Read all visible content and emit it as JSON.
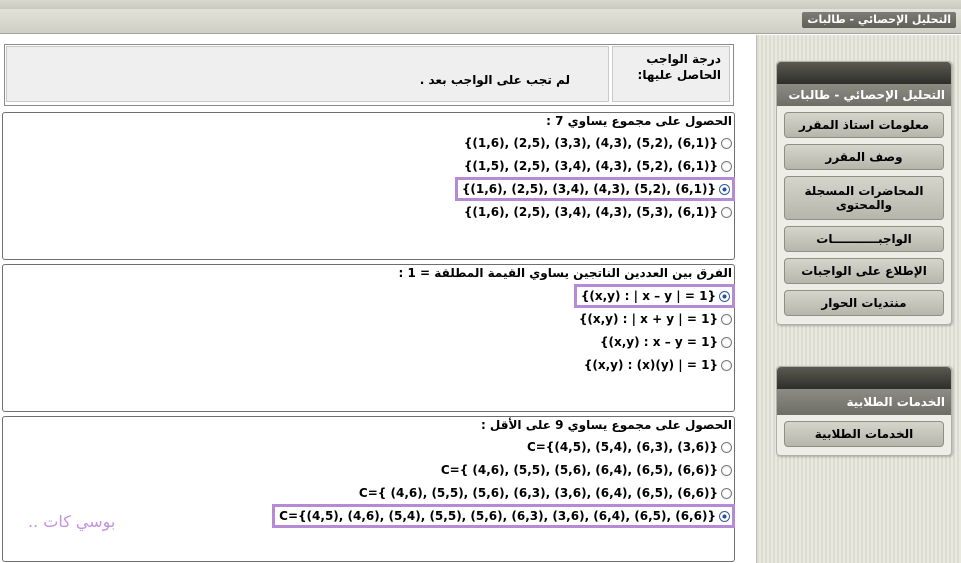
{
  "window": {
    "title": "التحليل الإحصائي - طالبات"
  },
  "grade": {
    "label": "درجة الواجب الحاصل عليها:",
    "value": "لم تجب على الواجب بعد ."
  },
  "questions": [
    {
      "text": "الحصول على مجموع يساوي 7 :",
      "selected_index": 2,
      "options": [
        "{(1,6), (2,5), (3,3), (4,3), (5,2), (6,1)}",
        "{(1,5), (2,5), (3,4), (4,3), (5,2), (6,1)}",
        "{(1,6), (2,5), (3,4), (4,3), (5,2), (6,1)}",
        "{(1,6), (2,5), (3,4), (4,3), (5,3), (6,1)}"
      ]
    },
    {
      "text": "الفرق بين العددين الناتجين يساوي القيمة المطلقة = 1 :",
      "selected_index": 0,
      "options": [
        "{(x,y) : | x – y | = 1}",
        "{(x,y) : | x + y | = 1}",
        "{(x,y) : x – y = 1}",
        "{(x,y) : (x)(y) | = 1}"
      ]
    },
    {
      "text": "الحصول على مجموع يساوي 9 على الأقل :",
      "selected_index": 3,
      "options": [
        "C={(4,5), (5,4), (6,3), (3,6)}",
        "C={ (4,6), (5,5), (5,6), (6,4), (6,5), (6,6)}",
        "C={ (4,6), (5,5), (5,6), (6,3), (3,6), (6,4), (6,5), (6,6)}",
        "C={(4,5), (4,6), (5,4), (5,5), (5,6), (6,3), (3,6), (6,4), (6,5), (6,6)}"
      ]
    }
  ],
  "watermark": "بوسي كات ..",
  "sidebar": {
    "course_panel": {
      "title": "التحليل الإحصائي - طالبات",
      "items": [
        "معلومات استاذ المقرر",
        "وصف المقرر",
        "المحاضرات المسجلة والمحتوى",
        "الواجبـــــــــــات",
        "الإطلاع على الواجبات",
        "منتديات الحوار"
      ]
    },
    "services_panel": {
      "title": "الخدمات الطلابية",
      "items": [
        "الخدمات الطلابية"
      ]
    }
  },
  "colors": {
    "highlight": "#b78ad8",
    "panel_header": "#6e6e66",
    "panel_top": "#2f2f2a"
  }
}
